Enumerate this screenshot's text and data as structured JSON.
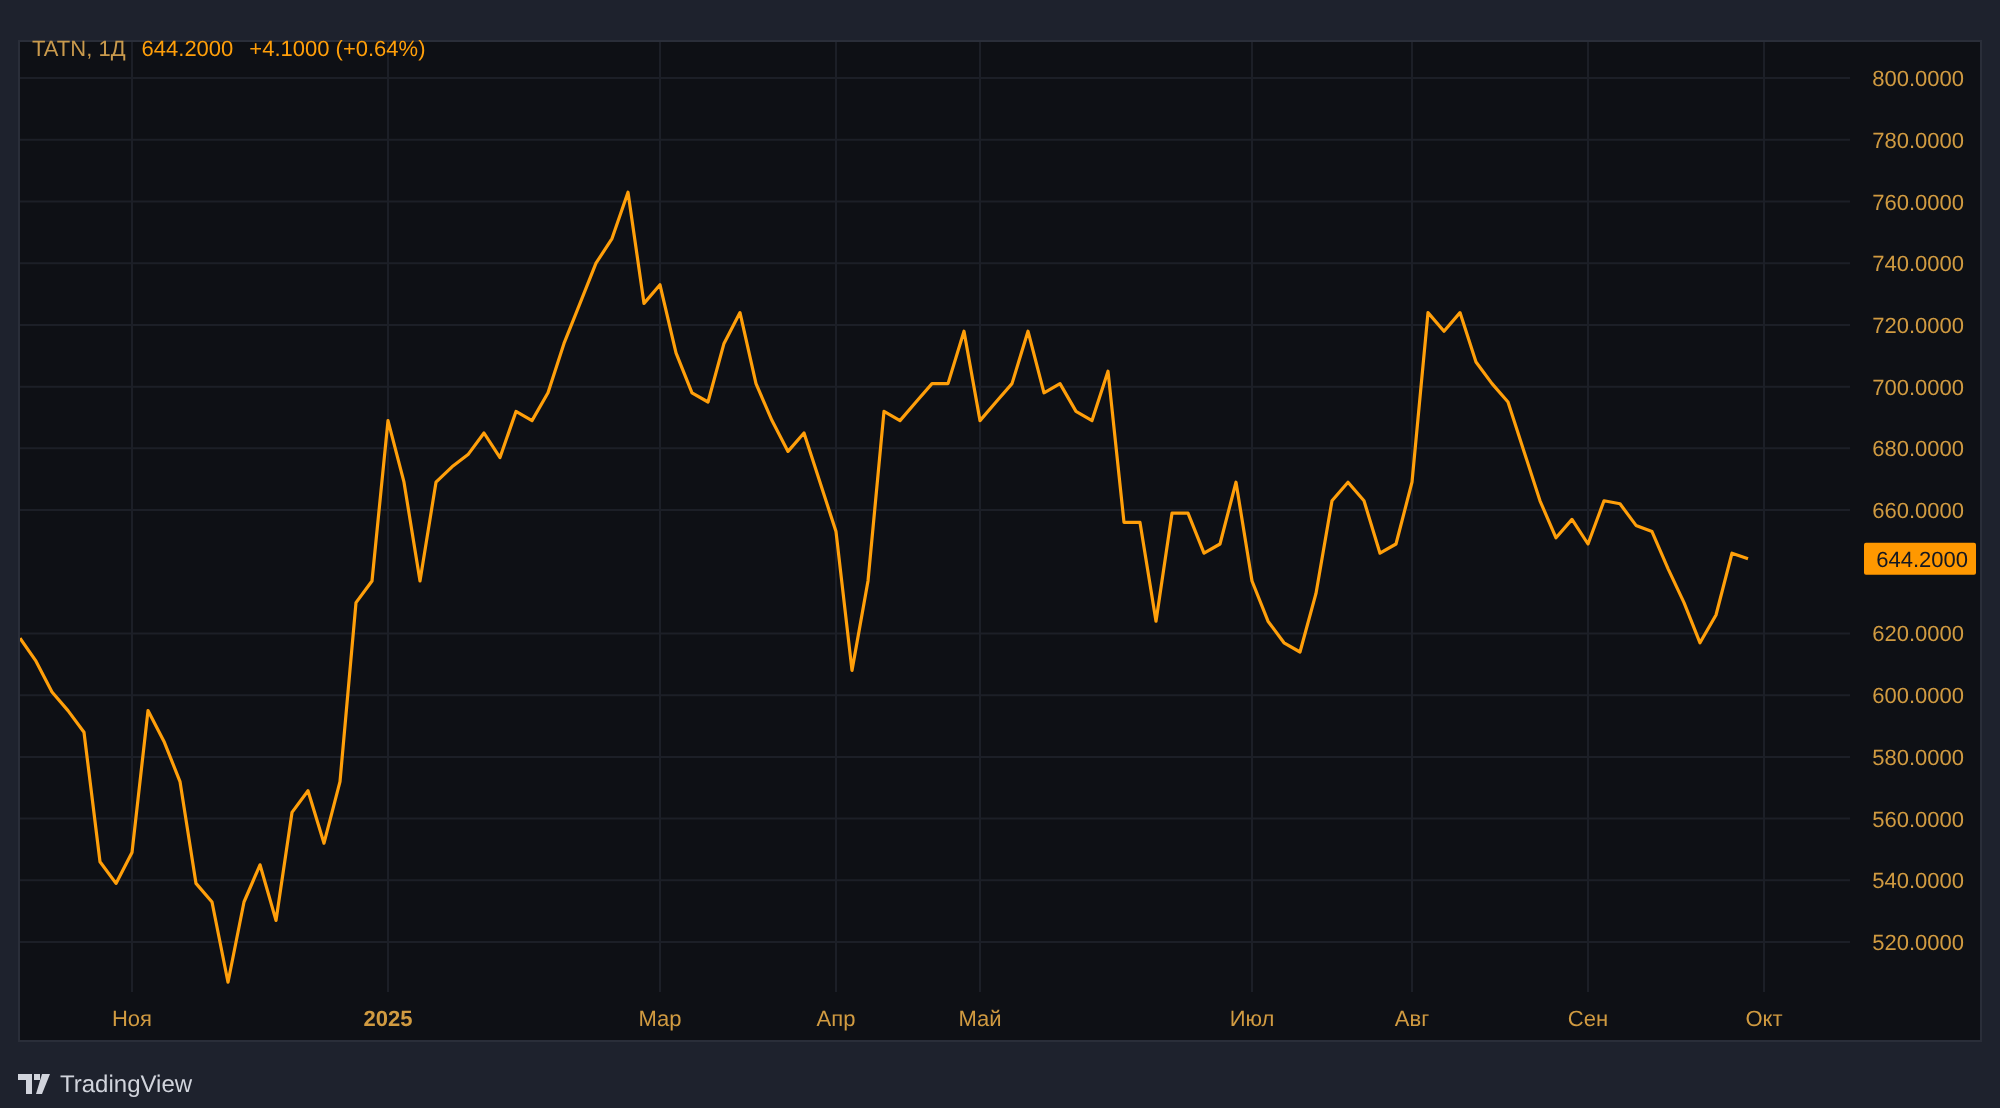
{
  "legend": {
    "symbol": "TATN, 1Д",
    "price": "644.2000",
    "change": "+4.1000 (+0.64%)"
  },
  "chart_data": {
    "type": "line",
    "grid": true,
    "ylim": [
      503.8,
      811.7
    ],
    "categories": [
      null,
      null,
      null,
      null,
      null,
      null,
      null,
      "Ноя",
      null,
      null,
      null,
      null,
      null,
      null,
      null,
      null,
      null,
      null,
      null,
      null,
      null,
      null,
      null,
      "2025",
      null,
      null,
      null,
      null,
      null,
      null,
      null,
      null,
      null,
      null,
      null,
      null,
      null,
      null,
      null,
      null,
      "Мар",
      null,
      null,
      null,
      null,
      null,
      null,
      null,
      null,
      null,
      null,
      "Апр",
      null,
      null,
      null,
      null,
      null,
      null,
      null,
      null,
      "Май",
      null,
      null,
      null,
      null,
      null,
      null,
      null,
      null,
      null,
      null,
      null,
      null,
      null,
      null,
      null,
      null,
      "Июл",
      null,
      null,
      null,
      null,
      null,
      null,
      null,
      null,
      null,
      "Авг",
      null,
      null,
      null,
      null,
      null,
      null,
      null,
      null,
      null,
      null,
      "Сен",
      null,
      null,
      null,
      null,
      null,
      null,
      null,
      null,
      null,
      null,
      "Окт"
    ],
    "yticks": [
      {
        "value": 800,
        "label": "800.0000"
      },
      {
        "value": 780,
        "label": "780.0000"
      },
      {
        "value": 760,
        "label": "760.0000"
      },
      {
        "value": 740,
        "label": "740.0000"
      },
      {
        "value": 720,
        "label": "720.0000"
      },
      {
        "value": 700,
        "label": "700.0000"
      },
      {
        "value": 680,
        "label": "680.0000"
      },
      {
        "value": 660,
        "label": "660.0000"
      },
      {
        "value": 620,
        "label": "620.0000"
      },
      {
        "value": 600,
        "label": "600.0000"
      },
      {
        "value": 580,
        "label": "580.0000"
      },
      {
        "value": 560,
        "label": "560.0000"
      },
      {
        "value": 540,
        "label": "540.0000"
      },
      {
        "value": 520,
        "label": "520.0000"
      }
    ],
    "series": [
      {
        "color": "#ff9f0a",
        "values": [
          618.5,
          611,
          601,
          595,
          588,
          546,
          539,
          549,
          595,
          585,
          572,
          539,
          533,
          507,
          533,
          545,
          527,
          562,
          569,
          552,
          572,
          630,
          637,
          689,
          669,
          637,
          669,
          674,
          678,
          685,
          677,
          692,
          689,
          698,
          714,
          727,
          740,
          748,
          763,
          727,
          733,
          711,
          698,
          695,
          714,
          724,
          701,
          689,
          679,
          685,
          669,
          653,
          608,
          637,
          692,
          689,
          695,
          701,
          701,
          718,
          689,
          695,
          701,
          718,
          698,
          701,
          692,
          689,
          705,
          656,
          656,
          624,
          659,
          659,
          646,
          649,
          669,
          637,
          624,
          617,
          614,
          633,
          663,
          669,
          663,
          646,
          649,
          669,
          724,
          718,
          724,
          708,
          701,
          695,
          679,
          663,
          651,
          657,
          649,
          663,
          662,
          655,
          653,
          641,
          630,
          617,
          626,
          646,
          644.2,
          null
        ]
      }
    ]
  },
  "price_tag": {
    "label": "644.2000"
  },
  "footer": {
    "brand": "TradingView"
  }
}
